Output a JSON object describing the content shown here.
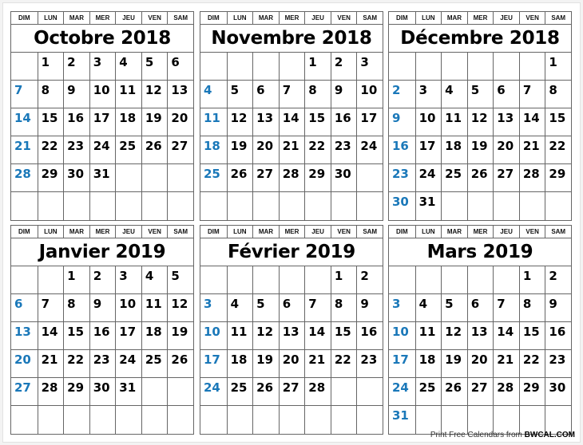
{
  "weekdays": [
    "DIM",
    "LUN",
    "MAR",
    "MER",
    "JEU",
    "VEN",
    "SAM"
  ],
  "calendars": [
    {
      "title": "Octobre 2018",
      "offset": 1,
      "days": 31
    },
    {
      "title": "Novembre 2018",
      "offset": 4,
      "days": 30
    },
    {
      "title": "Décembre 2018",
      "offset": 6,
      "days": 31
    },
    {
      "title": "Janvier 2019",
      "offset": 2,
      "days": 31
    },
    {
      "title": "Février 2019",
      "offset": 5,
      "days": 28
    },
    {
      "title": "Mars 2019",
      "offset": 5,
      "days": 31
    }
  ],
  "footer": {
    "prefix": "Print Free Calendars from ",
    "brand": "BWCAL.COM"
  },
  "colors": {
    "sunday": "#1a78b9",
    "text": "#000000",
    "grid": "#666666"
  }
}
